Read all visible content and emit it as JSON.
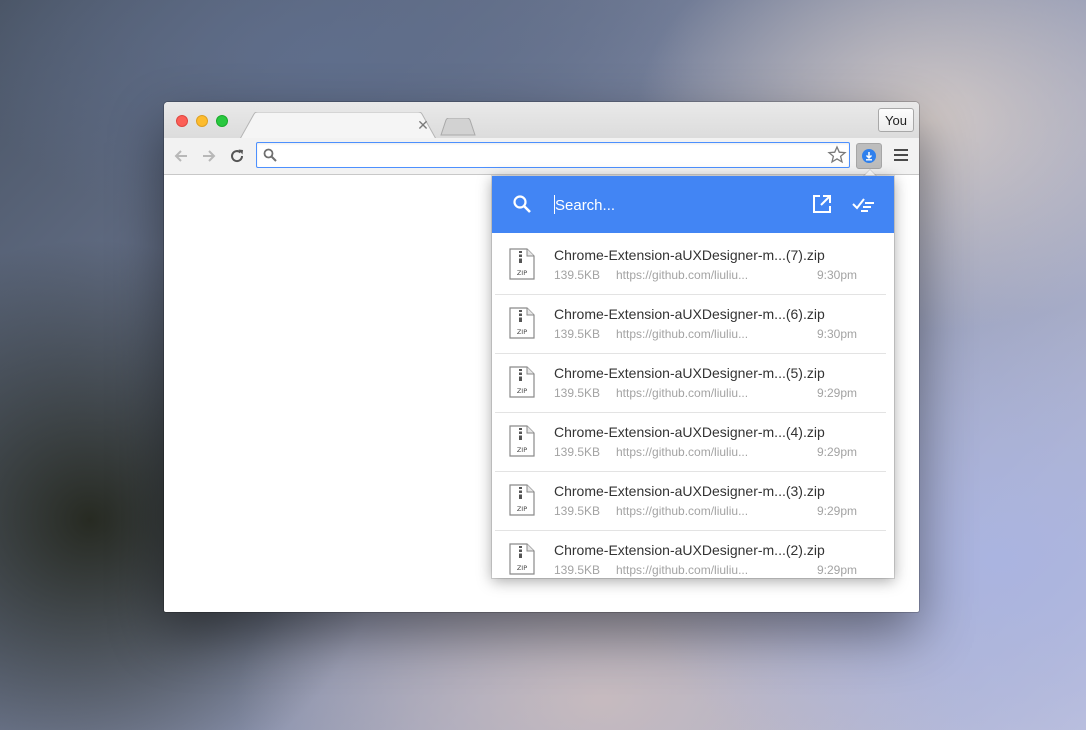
{
  "browser": {
    "profile_label": "You",
    "omnibox_value": ""
  },
  "popup": {
    "search_placeholder": "Search...",
    "accent_color": "#4285f4",
    "icons": {
      "search": "search-icon",
      "open_folder": "open-external-icon",
      "clear_all": "clear-all-icon"
    }
  },
  "downloads": [
    {
      "icon_label": "ZIP",
      "name": "Chrome-Extension-aUXDesigner-m...(7).zip",
      "size": "139.5KB",
      "url": "https://github.com/liuliu...",
      "time": "9:30pm"
    },
    {
      "icon_label": "ZIP",
      "name": "Chrome-Extension-aUXDesigner-m...(6).zip",
      "size": "139.5KB",
      "url": "https://github.com/liuliu...",
      "time": "9:30pm"
    },
    {
      "icon_label": "ZIP",
      "name": "Chrome-Extension-aUXDesigner-m...(5).zip",
      "size": "139.5KB",
      "url": "https://github.com/liuliu...",
      "time": "9:29pm"
    },
    {
      "icon_label": "ZIP",
      "name": "Chrome-Extension-aUXDesigner-m...(4).zip",
      "size": "139.5KB",
      "url": "https://github.com/liuliu...",
      "time": "9:29pm"
    },
    {
      "icon_label": "ZIP",
      "name": "Chrome-Extension-aUXDesigner-m...(3).zip",
      "size": "139.5KB",
      "url": "https://github.com/liuliu...",
      "time": "9:29pm"
    },
    {
      "icon_label": "ZIP",
      "name": "Chrome-Extension-aUXDesigner-m...(2).zip",
      "size": "139.5KB",
      "url": "https://github.com/liuliu...",
      "time": "9:29pm"
    }
  ]
}
